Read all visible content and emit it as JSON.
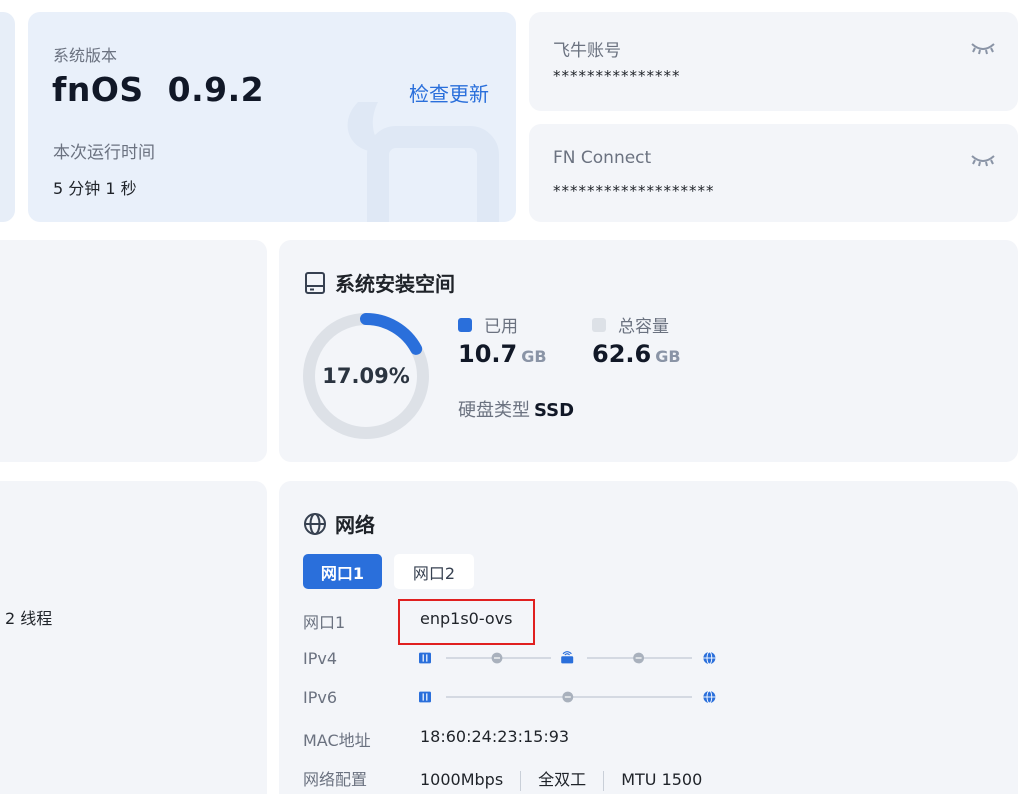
{
  "system": {
    "version_label": "系统版本",
    "version_value": "fnOS  0.9.2",
    "check_update": "检查更新",
    "uptime_label": "本次运行时间",
    "uptime_value": "5 分钟 1 秒"
  },
  "accounts": [
    {
      "label": "飞牛账号",
      "value": "***************"
    },
    {
      "label": "FN Connect",
      "value": "*******************"
    }
  ],
  "left_partial": {
    "threads_text": "2 线程"
  },
  "storage": {
    "title": "系统安装空间",
    "percent_label": "17.09%",
    "percent_used": 17.09,
    "used_label": "已用",
    "used_value": "10.7",
    "used_unit": "GB",
    "total_label": "总容量",
    "total_value": "62.6",
    "total_unit": "GB",
    "disk_type_label": "硬盘类型",
    "disk_type_value": "SSD",
    "colors": {
      "used": "#2a6fdb",
      "free": "#dde1e7"
    }
  },
  "network": {
    "title": "网络",
    "tabs": [
      "网口1",
      "网口2"
    ],
    "active_tab": 0,
    "rows": {
      "iface_label": "网口1",
      "iface_value": "enp1s0-ovs",
      "ipv4_label": "IPv4",
      "ipv6_label": "IPv6",
      "mac_label": "MAC地址",
      "mac_value": "18:60:24:23:15:93",
      "config_label": "网络配置",
      "speed": "1000Mbps",
      "duplex": "全双工",
      "mtu": "MTU 1500"
    },
    "icons": [
      "server-icon",
      "router-icon",
      "globe-icon",
      "status-dot-icon"
    ]
  }
}
